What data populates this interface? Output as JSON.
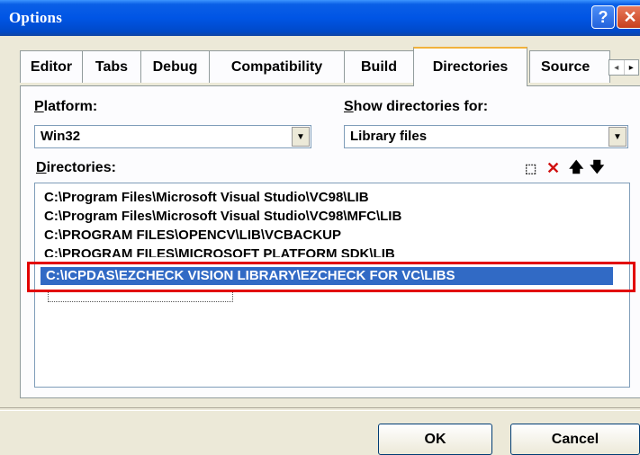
{
  "window": {
    "title": "Options",
    "help_glyph": "?",
    "close_glyph": "✕"
  },
  "tabs": [
    {
      "label": "Editor"
    },
    {
      "label": "Tabs"
    },
    {
      "label": "Debug"
    },
    {
      "label": "Compatibility"
    },
    {
      "label": "Build"
    },
    {
      "label": "Directories",
      "active": true
    },
    {
      "label": "Source"
    }
  ],
  "tab_scroll": {
    "left": "◂",
    "right": "▸"
  },
  "platform": {
    "label_u": "P",
    "label_rest": "latform:",
    "value": "Win32"
  },
  "show_for": {
    "label_u": "S",
    "label_rest": "how directories for:",
    "value": "Library files"
  },
  "directories": {
    "label_u": "D",
    "label_rest": "irectories:",
    "items": [
      "C:\\Program Files\\Microsoft Visual Studio\\VC98\\LIB",
      "C:\\Program Files\\Microsoft Visual Studio\\VC98\\MFC\\LIB",
      "C:\\PROGRAM FILES\\OPENCV\\LIB\\VCBACKUP",
      "C:\\PROGRAM FILES\\MICROSOFT PLATFORM SDK\\LIB",
      "C:\\ICPDAS\\EZCHECK VISION LIBRARY\\EZCHECK FOR VC\\LIBS"
    ],
    "selected_index": 4
  },
  "toolbar": {
    "new_icon": "⬚",
    "delete_icon": "✕",
    "up_icon": "🡅",
    "down_icon": "🡇"
  },
  "buttons": {
    "ok": "OK",
    "cancel": "Cancel"
  },
  "colors": {
    "selection": "#316ac5",
    "highlight_box": "#e20000",
    "active_tab_accent": "#f1b23b"
  }
}
